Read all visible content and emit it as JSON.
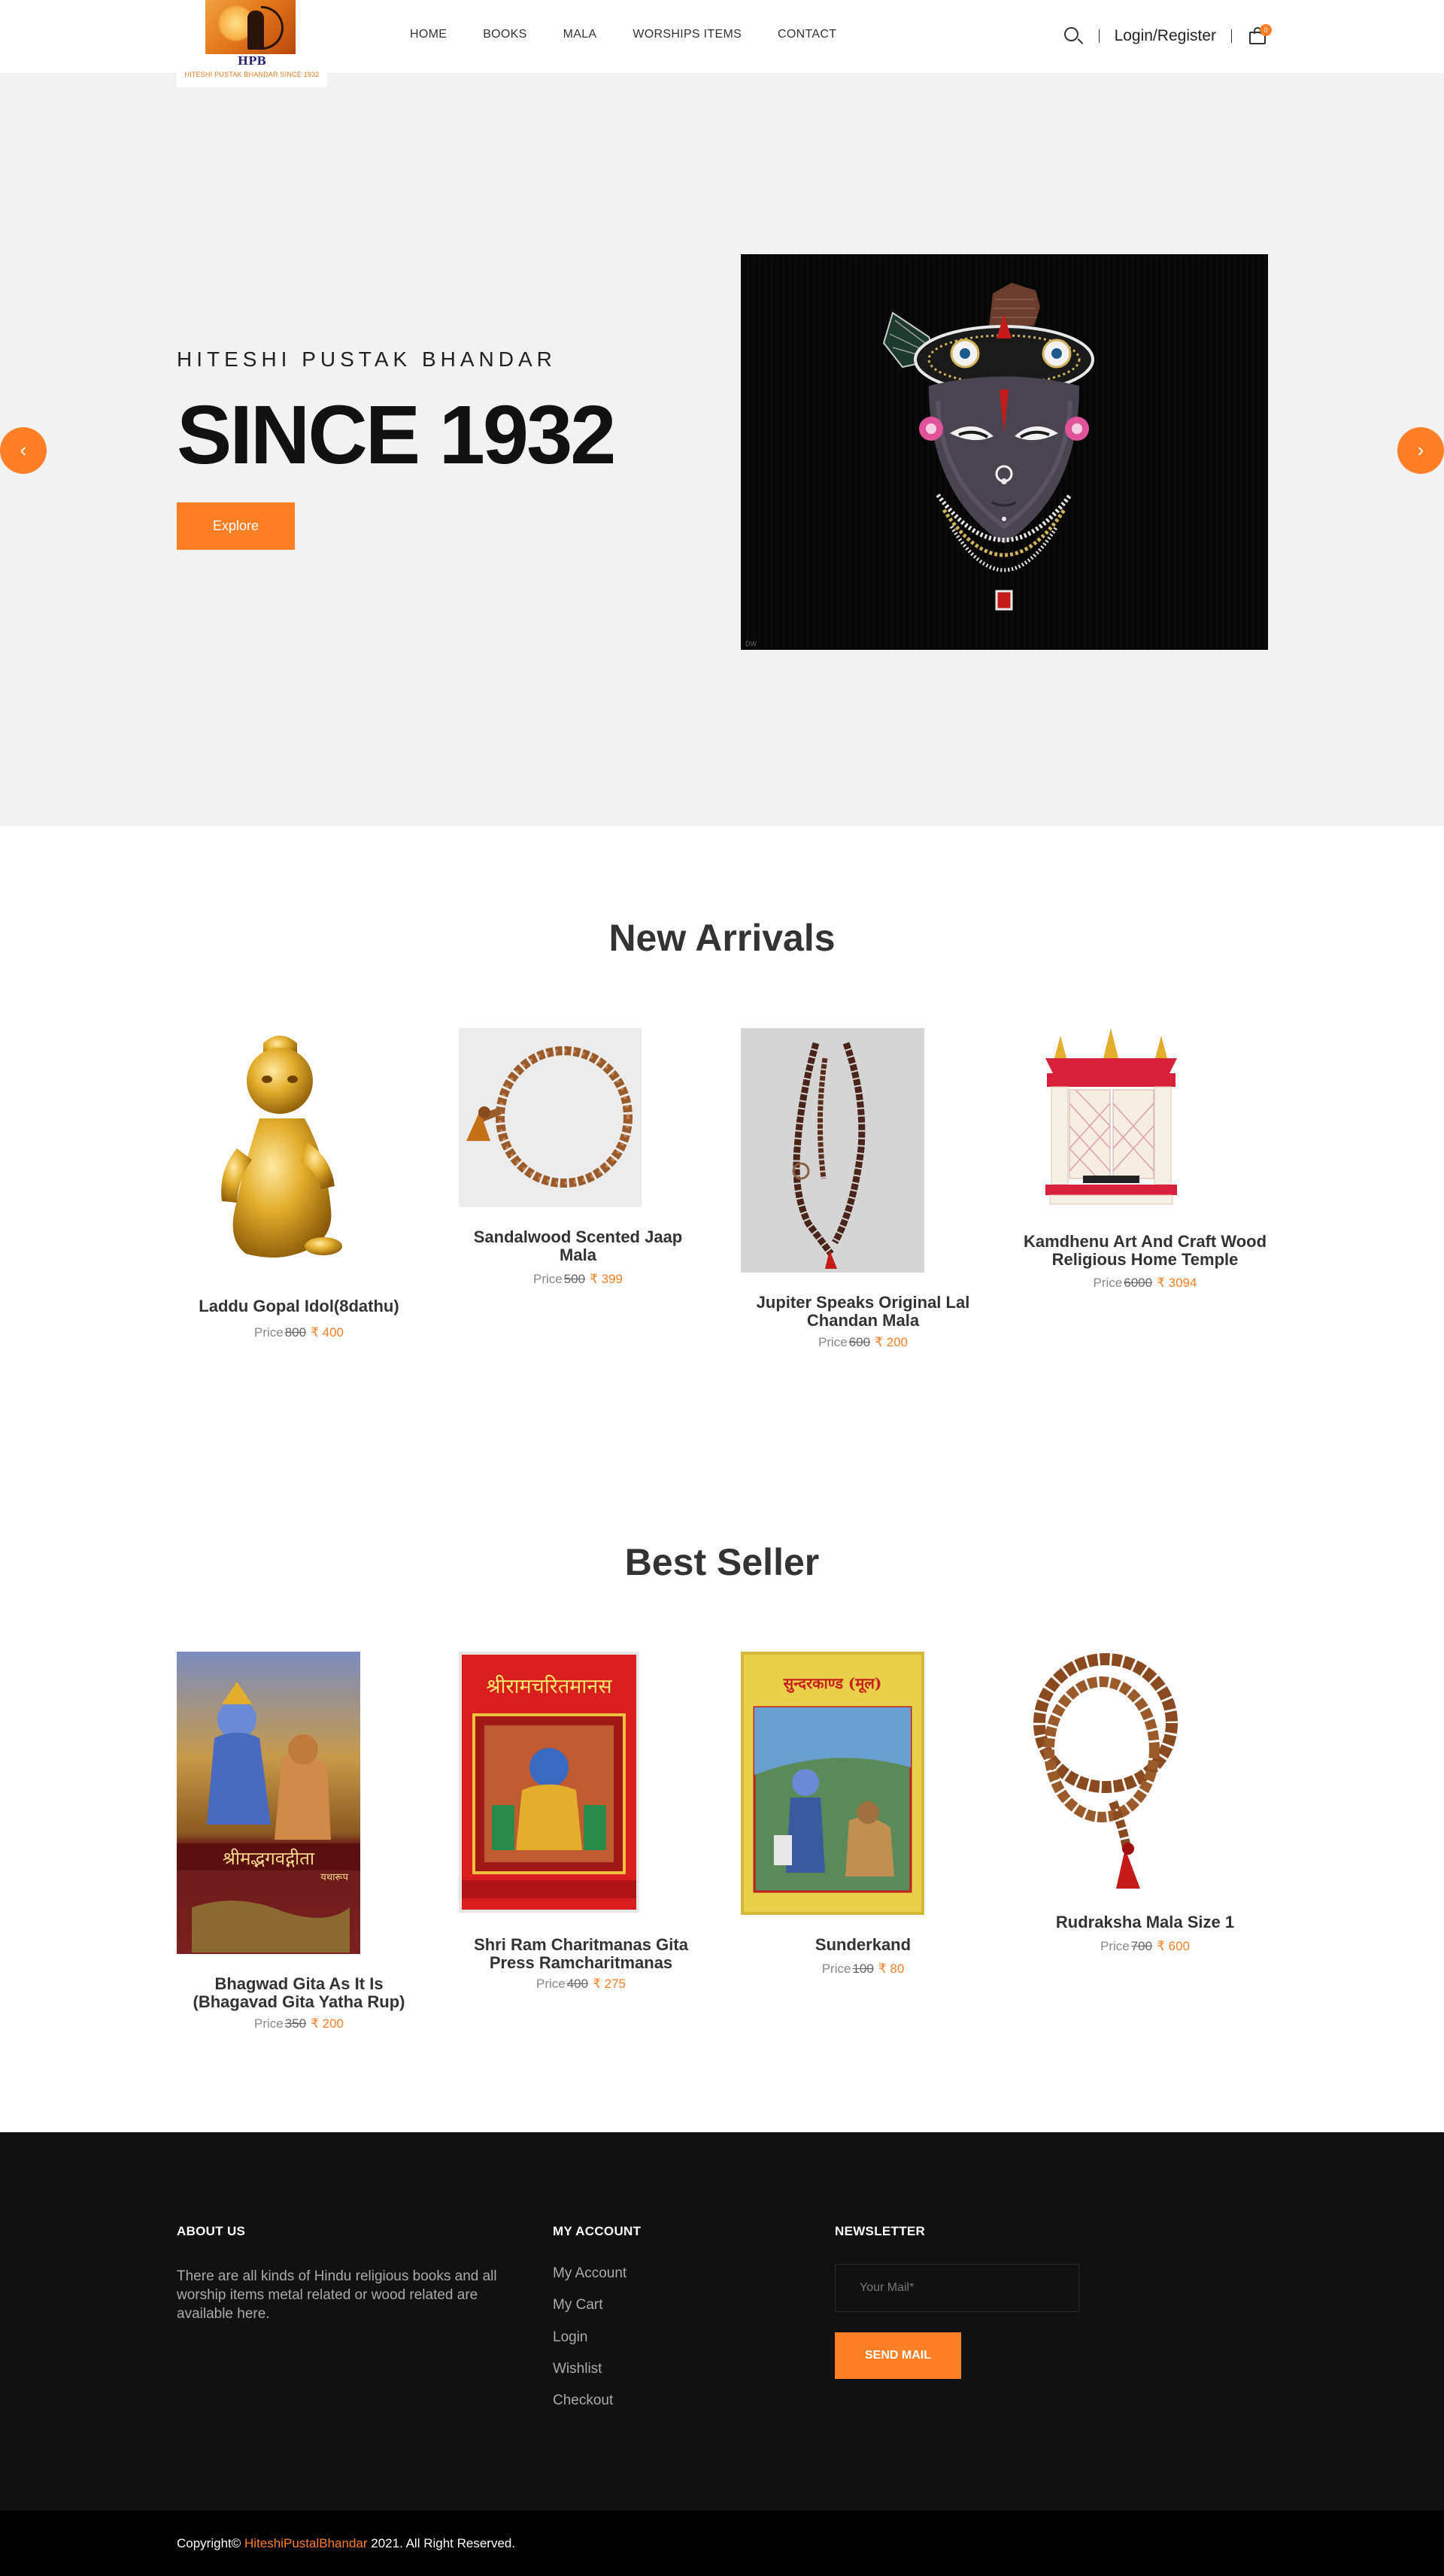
{
  "brand": {
    "logo_text": "HPB",
    "logo_tagline": "HITESHI PUSTAK BHANDAR SINCE 1932"
  },
  "nav": {
    "items": [
      "HOME",
      "BOOKS",
      "MALA",
      "WORSHIPS ITEMS",
      "CONTACT"
    ],
    "login": "Login/Register",
    "cart_count": "0",
    "icons": [
      "search-icon",
      "cart-icon"
    ]
  },
  "hero": {
    "eyebrow": "HITESHI PUSTAK BHANDAR",
    "title": "SINCE 1932",
    "button": "Explore",
    "image_watermark": "DW",
    "prev_arrow": "‹",
    "next_arrow": "›"
  },
  "new_arrivals": {
    "title": "New Arrivals",
    "products": [
      {
        "name": "Laddu Gopal Idol(8dathu)",
        "price_label": "Price",
        "old_price": "800",
        "new_price": "₹ 400"
      },
      {
        "name": "Sandalwood Scented Jaap Mala",
        "price_label": "Price",
        "old_price": "500",
        "new_price": "₹ 399"
      },
      {
        "name": "Jupiter Speaks Original Lal Chandan Mala",
        "price_label": "Price",
        "old_price": "600",
        "new_price": "₹ 200"
      },
      {
        "name": "Kamdhenu Art And Craft Wood Religious Home Temple",
        "price_label": "Price",
        "old_price": "6000",
        "new_price": "₹ 3094"
      }
    ]
  },
  "best_seller": {
    "title": "Best Seller",
    "products": [
      {
        "name": "Bhagwad Gita As It Is (Bhagavad Gita Yatha Rup)",
        "price_label": "Price",
        "old_price": "350",
        "new_price": "₹ 200"
      },
      {
        "name": "Shri Ram Charitmanas Gita Press Ramcharitmanas",
        "price_label": "Price",
        "old_price": "400",
        "new_price": "₹ 275"
      },
      {
        "name": "Sunderkand",
        "price_label": "Price",
        "old_price": "100",
        "new_price": "₹ 80"
      },
      {
        "name": "Rudraksha Mala Size 1",
        "price_label": "Price",
        "old_price": "700",
        "new_price": "₹ 600"
      }
    ]
  },
  "book_covers": {
    "gita": "श्रीमद्भगवद्गीता",
    "gita_sub": "यथारूप",
    "ramcharit": "श्रीरामचरितमानस",
    "sunderkand": "सुन्दरकाण्ड (मूल)"
  },
  "footer": {
    "about_title": "ABOUT US",
    "about_text": "There are all kinds of Hindu religious books and all worship items metal related or wood related are available here.",
    "account_title": "MY ACCOUNT",
    "account_links": [
      "My Account",
      "My Cart",
      "Login",
      "Wishlist",
      "Checkout"
    ],
    "newsletter_title": "NEWSLETTER",
    "mail_placeholder": "Your Mail*",
    "send_button": "SEND MAIL",
    "copyright_prefix": "Copyright©",
    "copyright_brand": "HiteshiPustalBhandar",
    "copyright_suffix": "2021. All Right Reserved."
  }
}
